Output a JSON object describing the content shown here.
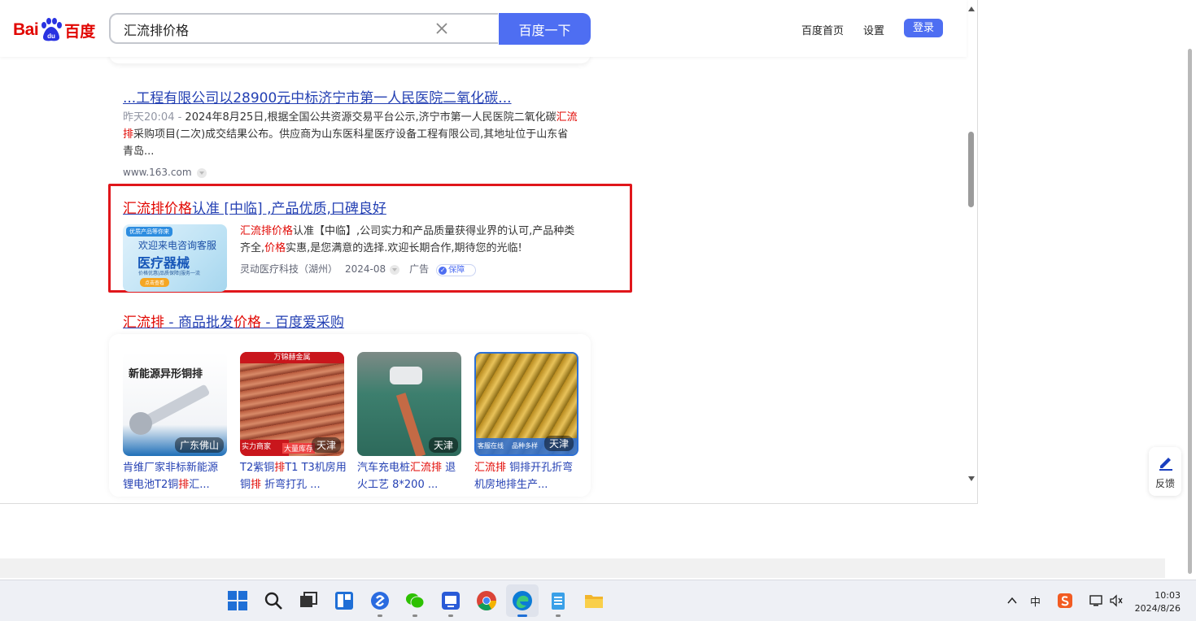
{
  "header": {
    "logo_latin": "Bai",
    "logo_du": "du",
    "logo_cn": "百度",
    "search_value": "汇流排价格",
    "search_button": "百度一下",
    "home_link": "百度首页",
    "settings_link": "设置",
    "login_button": "登录"
  },
  "results": [
    {
      "title": "...工程有限公司以28900元中标济宁市第一人民医院二氧化碳...",
      "time": "昨天20:04 - ",
      "snippet_a": "2024年8月25日,根据全国公共资源交易平台公示,济宁市第一人民医院二氧化碳",
      "snippet_em": "汇流排",
      "snippet_b": "采购项目(二次)成交结果公布。供应商为山东医科星医疗设备工程有限公司,其地址位于山东省青岛...",
      "source": "www.163.com"
    }
  ],
  "ad": {
    "title_em": "汇流排价格",
    "title_rest": "认准 [中临] ,产品优质,口碑良好",
    "image_tag": "优质产品等你来",
    "image_line1": "欢迎来电咨询客服",
    "image_line2": "医疗器械",
    "image_line3": "价格优惠|品质保障|服务一流",
    "image_button": "点击查看",
    "desc_em1": "汇流排价格",
    "desc_a": "认准【中临】,公司实力和产品质量获得业界的认可,产品种类齐全,",
    "desc_em2": "价格",
    "desc_b": "实惠,是您满意的选择.欢迎长期合作,期待您的光临!",
    "company": "灵动医疗科技（湖州）",
    "date": "2024-08",
    "ad_label": "广告",
    "guarantee": "保障"
  },
  "aicaigou": {
    "title_em1": "汇流排",
    "title_mid": " - 商品批发",
    "title_em2": "价格",
    "title_end": " - 百度爱采购",
    "products": [
      {
        "image_text": "新能源异形铜排",
        "location": "广东佛山",
        "cap1_a": "肯维厂家非标新能源",
        "cap1_em": "",
        "cap2_a": "锂电池T2铜",
        "cap2_em": "排",
        "cap2_b": "汇..."
      },
      {
        "image_text": "万锦赫金属",
        "badge1": "实力商家",
        "badge2": "大量库存",
        "location": "天津",
        "cap1_a": "T2紫铜",
        "cap1_em": "排",
        "cap1_b": "T1 T3机房用",
        "cap2_a": "铜",
        "cap2_em": "排",
        "cap2_b": " 折弯打孔 ..."
      },
      {
        "location": "天津",
        "cap1_a": "汽车充电桩",
        "cap1_em": "汇流排",
        "cap1_b": " 退",
        "cap2_a": "火工艺 8*200 ...",
        "cap2_em": "",
        "cap2_b": ""
      },
      {
        "badge1": "客服在线",
        "badge2": "品种多样",
        "location": "天津",
        "cap1_a": "",
        "cap1_em": "汇流排",
        "cap1_b": " 铜排开孔折弯",
        "cap2_a": "机房地排生产...",
        "cap2_em": "",
        "cap2_b": ""
      }
    ]
  },
  "feedback": "反馈",
  "taskbar": {
    "ime": "中",
    "time": "10:03",
    "date": "2024/8/26"
  },
  "colors": {
    "accent": "#4e6ef2",
    "highlight": "#e10601",
    "link": "#2440b3",
    "ad_border": "#e0161b"
  }
}
